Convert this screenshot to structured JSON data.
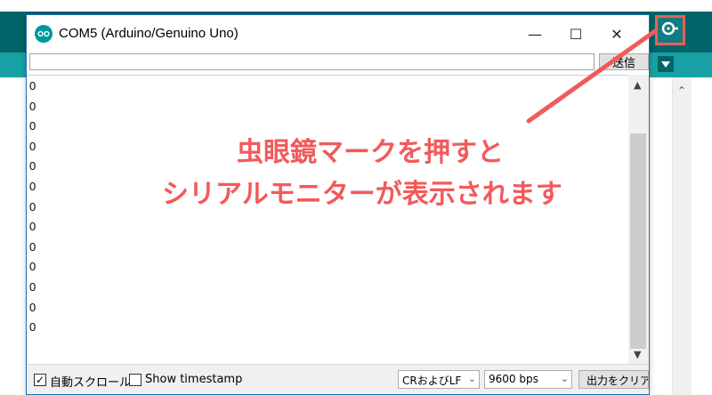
{
  "window": {
    "title": "COM5 (Arduino/Genuino Uno)",
    "minimize_glyph": "—",
    "maximize_glyph": "☐",
    "close_glyph": "✕"
  },
  "input": {
    "value": "",
    "send_label": "送信"
  },
  "output": {
    "lines": [
      "0",
      "0",
      "0",
      "0",
      "0",
      "0",
      "0",
      "0",
      "0",
      "0",
      "0",
      "0",
      "0"
    ]
  },
  "status": {
    "autoscroll_label": "自動スクロール",
    "autoscroll_checked": true,
    "timestamp_label": "Show timestamp",
    "timestamp_checked": false,
    "line_ending": "CRおよびLF",
    "baud_rate": "9600 bps",
    "clear_label": "出力をクリア"
  },
  "annotation": {
    "line1": "虫眼鏡マークを押すと",
    "line2": "シリアルモニターが表示されます",
    "color": "#f25a5a"
  },
  "colors": {
    "ide_dark": "#006468",
    "ide_teal": "#17a1a5",
    "highlight": "#f25a5a"
  }
}
